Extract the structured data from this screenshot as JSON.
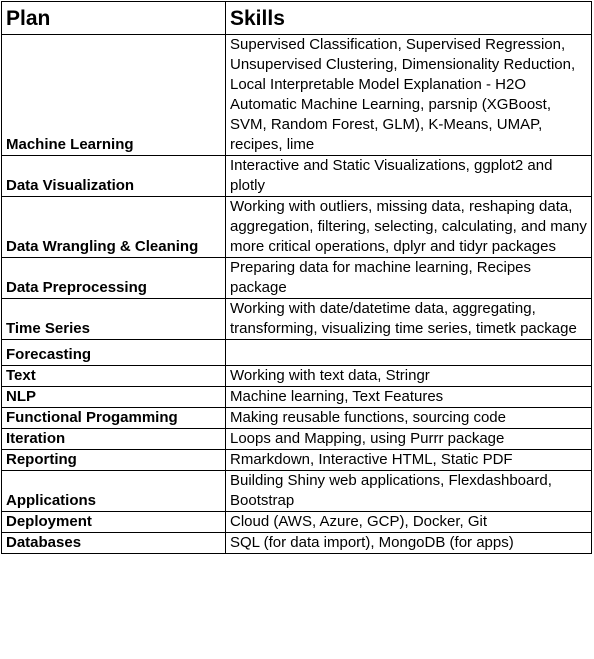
{
  "headers": {
    "plan": "Plan",
    "skills": "Skills"
  },
  "rows": [
    {
      "plan": "Machine Learning",
      "skills": "Supervised Classification, Supervised Regression, Unsupervised Clustering, Dimensionality Reduction, Local Interpretable Model Explanation - H2O Automatic Machine Learning, parsnip (XGBoost, SVM, Random Forest, GLM), K-Means, UMAP, recipes, lime"
    },
    {
      "plan": "Data Visualization",
      "skills": "Interactive and Static Visualizations, ggplot2 and plotly"
    },
    {
      "plan": "Data Wrangling & Cleaning",
      "skills": "Working with outliers, missing data, reshaping data, aggregation, filtering, selecting, calculating, and many more critical operations, dplyr and tidyr packages"
    },
    {
      "plan": "Data Preprocessing",
      "skills": "Preparing data for machine learning, Recipes package"
    },
    {
      "plan": "Time Series",
      "skills": "Working with date/datetime data, aggregating, transforming, visualizing time series, timetk package"
    },
    {
      "plan": "Forecasting",
      "skills": ""
    },
    {
      "plan": "Text",
      "skills": "Working with text data, Stringr"
    },
    {
      "plan": "NLP",
      "skills": "Machine learning, Text Features"
    },
    {
      "plan": "Functional Progamming",
      "skills": "Making reusable functions, sourcing code"
    },
    {
      "plan": "Iteration",
      "skills": "Loops and Mapping, using Purrr package"
    },
    {
      "plan": "Reporting",
      "skills": "Rmarkdown, Interactive HTML, Static PDF"
    },
    {
      "plan": "Applications",
      "skills": "Building Shiny web applications, Flexdashboard, Bootstrap"
    },
    {
      "plan": "Deployment",
      "skills": "Cloud (AWS, Azure, GCP), Docker, Git"
    },
    {
      "plan": "Databases",
      "skills": "SQL (for data import), MongoDB (for apps)"
    }
  ]
}
